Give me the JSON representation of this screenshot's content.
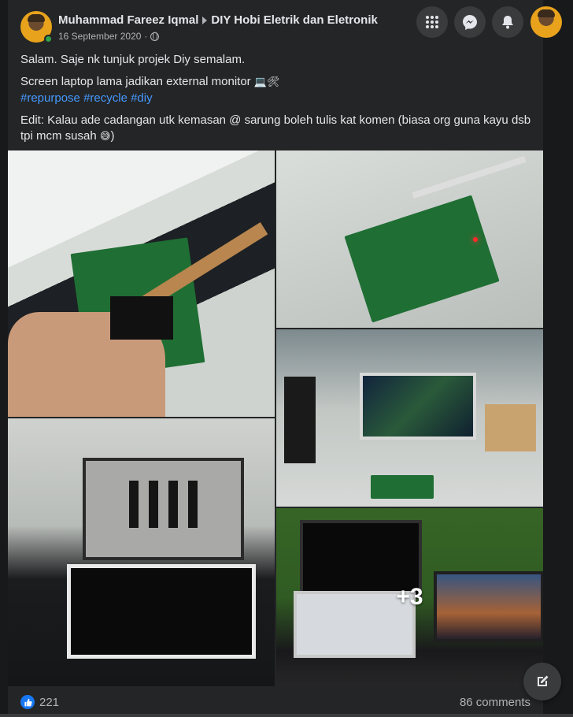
{
  "post": {
    "author": "Muhammad Fareez Iqmal",
    "group": "DIY Hobi Eletrik dan Eletronik",
    "date": "16 September 2020",
    "separator": "·",
    "privacy_icon": "globe-icon",
    "text_line1": "Salam. Saje nk tunjuk projek Diy semalam.",
    "text_line2": "Screen laptop lama jadikan external monitor",
    "text_line2_emojis": "💻🛠",
    "hashtags": [
      "#repurpose",
      "#recycle",
      "#diy"
    ],
    "text_line3": "Edit: Kalau ade cadangan utk kemasan @ sarung boleh tulis kat komen (biasa org guna kayu dsb tpi mcm susah",
    "text_line3_emoji": "😅",
    "text_line3_end": ")"
  },
  "gallery": {
    "more_label": "+3"
  },
  "footer": {
    "reaction_icon": "like-icon",
    "like_count": "221",
    "comment_count": "86 comments"
  },
  "topbar": {
    "icons": [
      "menu-grid-icon",
      "messenger-icon",
      "notifications-icon"
    ]
  },
  "colors": {
    "background": "#18191a",
    "card": "#242526",
    "hashtag": "#4599ff",
    "like": "#1877f2",
    "online": "#31a24c"
  }
}
